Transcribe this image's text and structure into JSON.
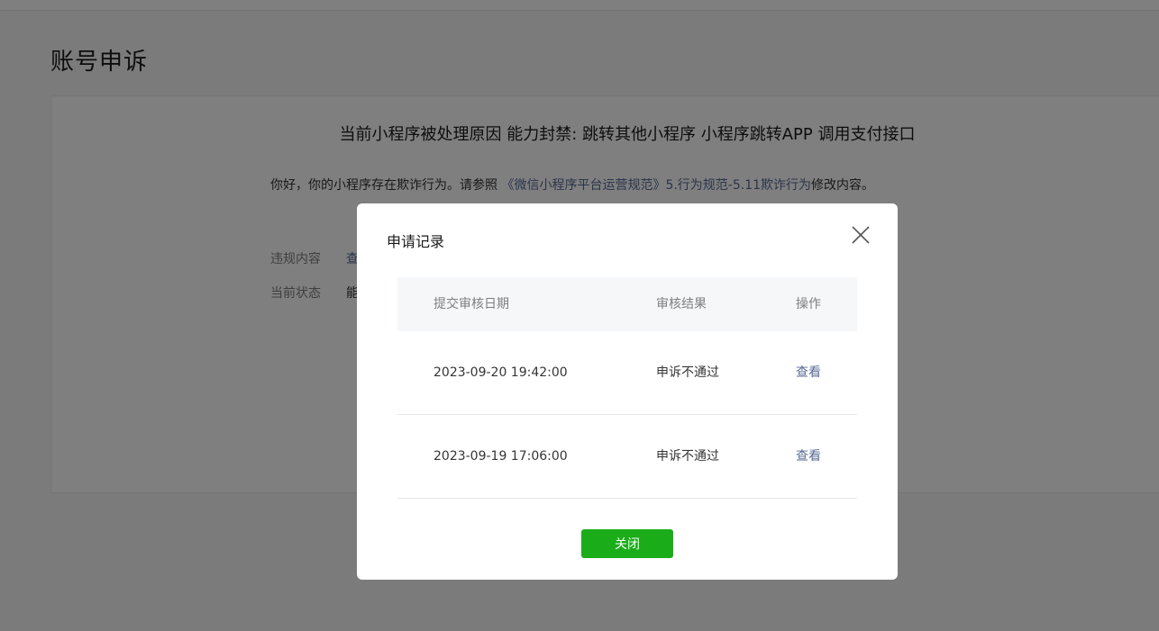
{
  "page": {
    "title": "账号申诉"
  },
  "card": {
    "reason_title": "当前小程序被处理原因 能力封禁: 跳转其他小程序 小程序跳转APP 调用支付接口",
    "notice_prefix": "你好，你的小程序存在欺诈行为。请参照 ",
    "notice_link": "《微信小程序平台运营规范》5.行为规范-5.11欺诈行为",
    "notice_suffix": "修改内容。",
    "fields": [
      {
        "label": "违规内容",
        "value": "查"
      },
      {
        "label": "当前状态",
        "value": "能"
      }
    ]
  },
  "dialog": {
    "title": "申请记录",
    "columns": [
      "提交审核日期",
      "审核结果",
      "操作"
    ],
    "rows": [
      {
        "date": "2023-09-20 19:42:00",
        "result": "申诉不通过",
        "action": "查看"
      },
      {
        "date": "2023-09-19 17:06:00",
        "result": "申诉不通过",
        "action": "查看"
      }
    ],
    "close_button": "关闭"
  },
  "colors": {
    "primary_green": "#1aad19",
    "link_blue": "#576b95",
    "overlay": "rgba(0,0,0,0.5)"
  }
}
